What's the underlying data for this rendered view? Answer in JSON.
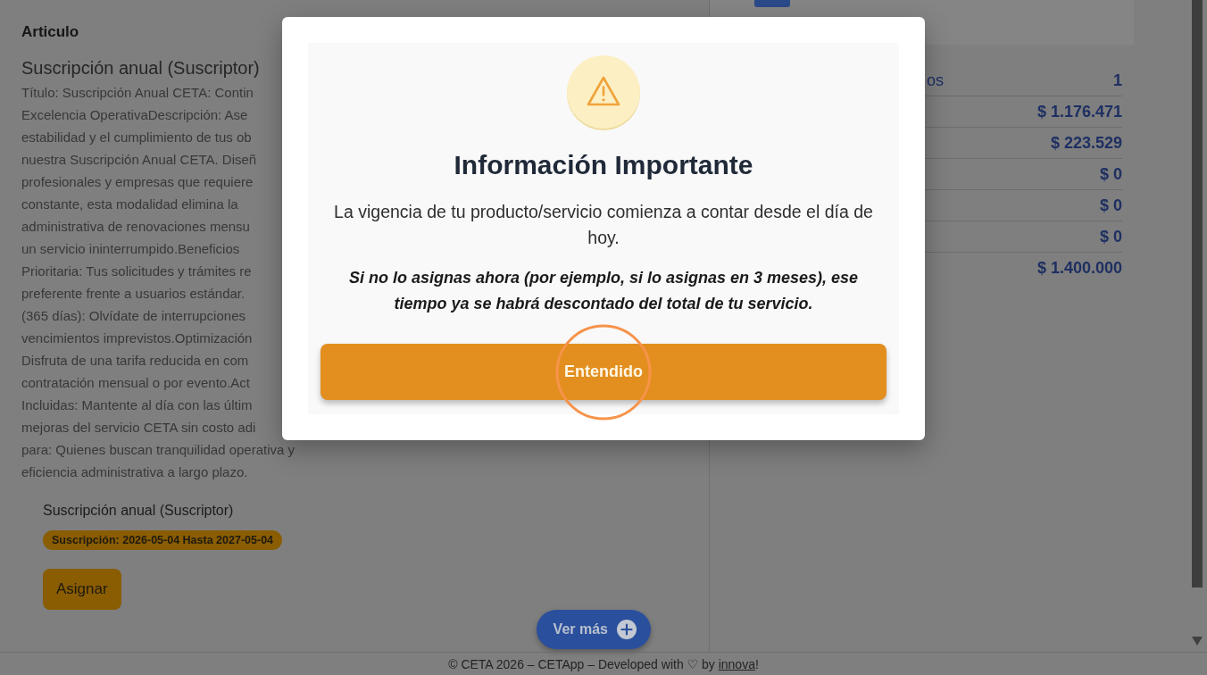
{
  "article": {
    "heading": "Articulo",
    "title": "Suscripción anual (Suscriptor)",
    "description_lines": [
      "Título: Suscripción Anual CETA: Contin",
      "Excelencia OperativaDescripción: Ase",
      "estabilidad y el cumplimiento de tus ob",
      "nuestra Suscripción Anual CETA. Diseñ",
      "profesionales y empresas que requiere",
      "constante, esta modalidad elimina la",
      "administrativa de renovaciones mensu",
      "un servicio ininterrumpido.Beneficios",
      "Prioritaria: Tus solicitudes y trámites re",
      "preferente frente a usuarios estándar.",
      "(365 días): Olvídate de interrupciones",
      "vencimientos imprevistos.Optimización",
      "Disfruta de una tarifa reducida en com",
      "contratación mensual o por evento.Act",
      "Incluidas: Mantente al día con las últim",
      "mejoras del servicio CETA sin costo adi",
      "para: Quienes buscan tranquilidad operativa y",
      "eficiencia administrativa a largo plazo."
    ]
  },
  "item": {
    "name": "Suscripción anual (Suscriptor)",
    "tag": "Suscripción: 2026-05-04 Hasta 2027-05-04",
    "assign_button": "Asignar"
  },
  "more_button": {
    "label": "Ver más"
  },
  "summary": {
    "rows": [
      {
        "label": "os",
        "value": "1"
      },
      {
        "value": "$ 1.176.471"
      },
      {
        "value": "$ 223.529"
      },
      {
        "value": "$ 0"
      },
      {
        "value": "$ 0"
      },
      {
        "value": "$ 0"
      },
      {
        "value": "$ 1.400.000"
      }
    ]
  },
  "modal": {
    "title": "Información Importante",
    "message": "La vigencia de tu producto/servicio comienza a contar desde el día de hoy.",
    "note": "Si no lo asignas ahora (por ejemplo, si lo asignas en 3 meses), ese tiempo ya se habrá descontado del total de tu servicio.",
    "button": "Entendido"
  },
  "footer": {
    "text": "© CETA 2026 – CETApp – Developed with ♡ by ",
    "link": "innova",
    "suffix": "!"
  }
}
